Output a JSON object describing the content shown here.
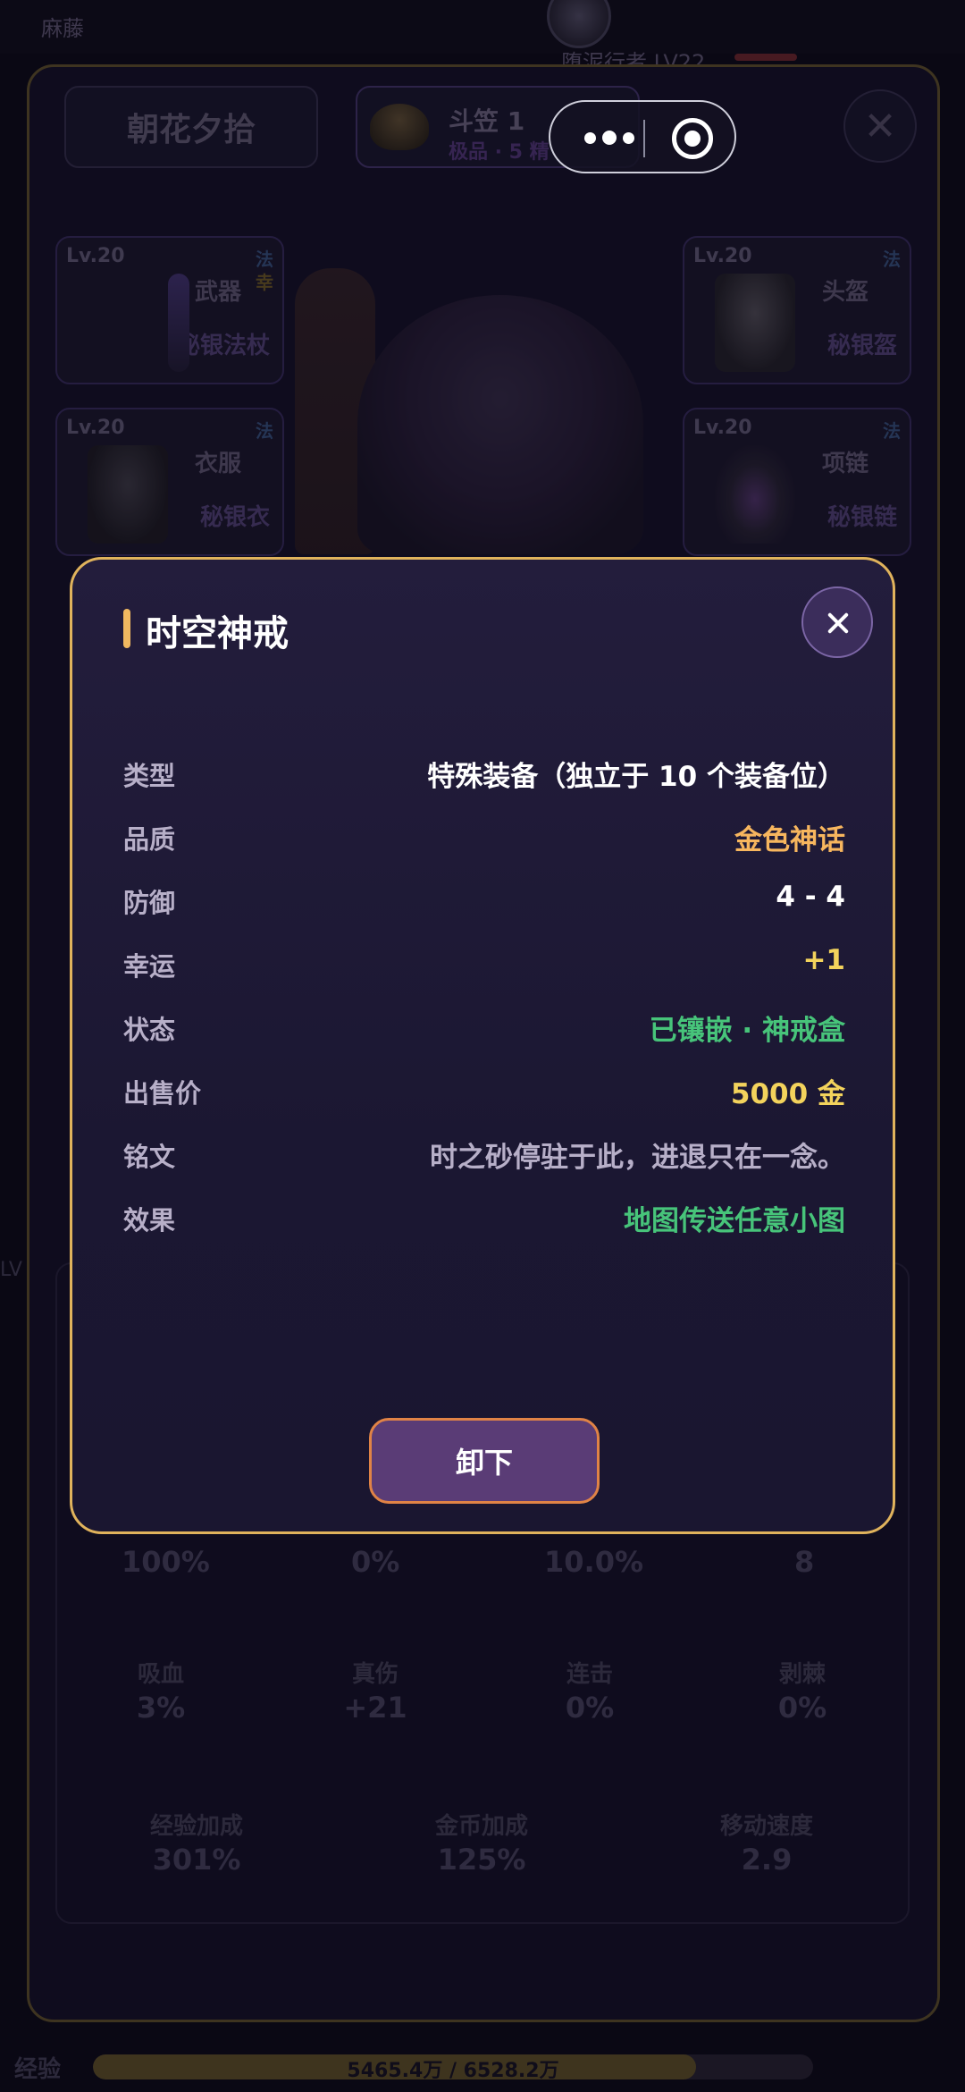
{
  "background": {
    "top_label": "麻藤",
    "monster_name": "堕泥行者 LV22",
    "panel_tab": "朝花夕拾",
    "selected_item": {
      "name": "斗笠 1",
      "sub": "极品 · 5 精"
    },
    "slots": [
      {
        "lv": "Lv.20",
        "tag": "法",
        "tag2": "幸",
        "type": "武器",
        "name": "秘银法杖"
      },
      {
        "lv": "Lv.20",
        "tag": "法",
        "tag2": "",
        "type": "头盔",
        "name": "秘银盔"
      },
      {
        "lv": "Lv.20",
        "tag": "法",
        "tag2": "",
        "type": "衣服",
        "name": "秘银衣"
      },
      {
        "lv": "Lv.20",
        "tag": "法",
        "tag2": "",
        "type": "项链",
        "name": "秘银链"
      }
    ],
    "stats_row1": [
      "100%",
      "0%",
      "10.0%",
      "8"
    ],
    "stats_row2": [
      {
        "label": "吸血",
        "value": "3%"
      },
      {
        "label": "真伤",
        "value": "+21"
      },
      {
        "label": "连击",
        "value": "0%"
      },
      {
        "label": "剥棘",
        "value": "0%"
      }
    ],
    "stats_row3": [
      {
        "label": "经验加成",
        "value": "301%"
      },
      {
        "label": "金币加成",
        "value": "125%"
      },
      {
        "label": "移动速度",
        "value": "2.9"
      }
    ],
    "side_label": "LV",
    "exp": {
      "label": "经验",
      "text": "5465.4万 / 6528.2万",
      "fraction": 0.837
    }
  },
  "dialog": {
    "title": "时空神戒",
    "rows": [
      {
        "key": "类型",
        "value": "特殊装备（独立于 10 个装备位）",
        "color": "#ffffff"
      },
      {
        "key": "品质",
        "value": "金色神话",
        "color": "#f7b65e"
      },
      {
        "key": "防御",
        "value": "4 - 4",
        "color": "#ffffff"
      },
      {
        "key": "幸运",
        "value": "+1",
        "color": "#f3d35c"
      },
      {
        "key": "状态",
        "value": "已镶嵌 · 神戒盒",
        "color": "#47c47a"
      },
      {
        "key": "出售价",
        "value": "5000 金",
        "color": "#f3d35c"
      },
      {
        "key": "铭文",
        "value": "时之砂停驻于此，进退只在一念。",
        "color": "#b7afc8"
      },
      {
        "key": "效果",
        "value": "地图传送任意小图",
        "color": "#47c47a"
      }
    ],
    "button_label": "卸下"
  },
  "colors": {
    "dialog_border": "#e0b35c",
    "accent": "#f0b860",
    "button_border": "#e08346",
    "button_bg": "#5a3c76"
  }
}
